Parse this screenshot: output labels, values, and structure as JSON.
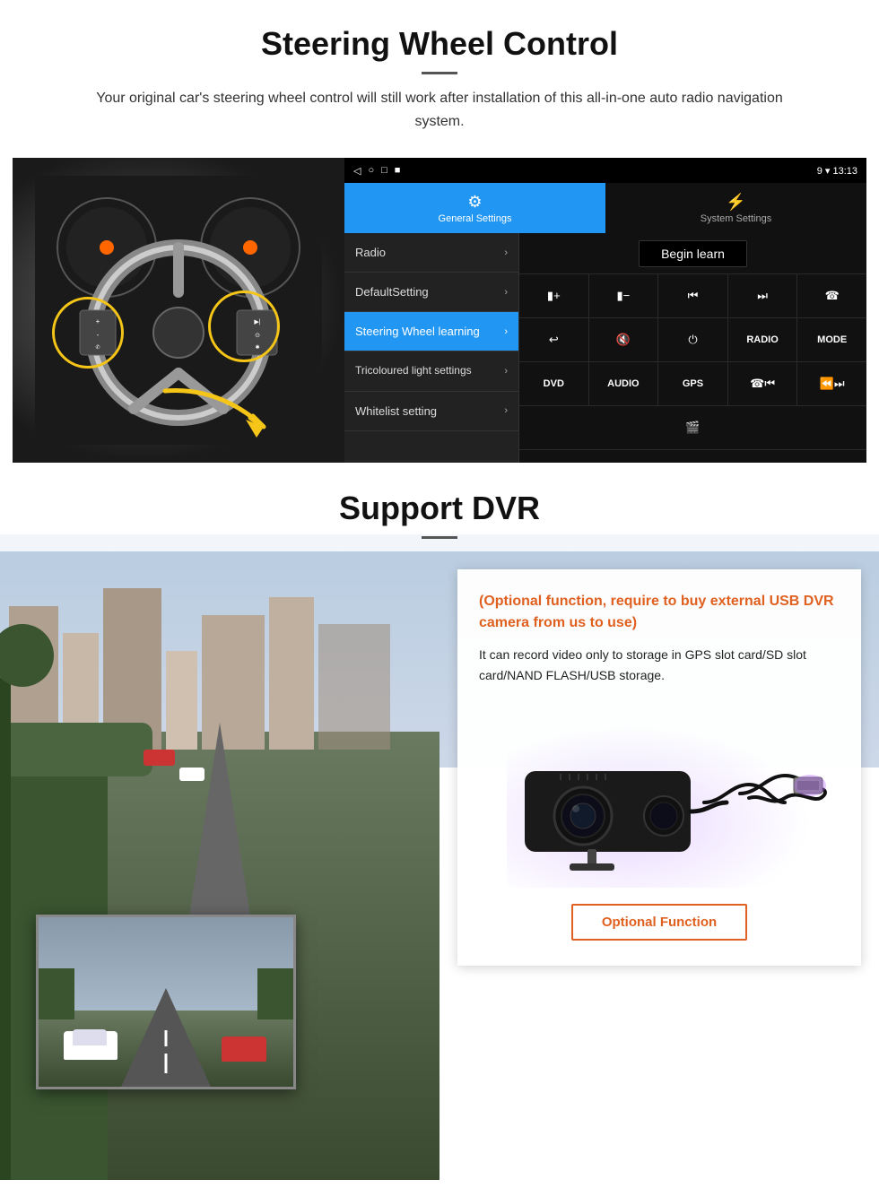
{
  "page": {
    "section1": {
      "title": "Steering Wheel Control",
      "description": "Your original car's steering wheel control will still work after installation of this all-in-one auto radio navigation system.",
      "android_ui": {
        "status_bar": {
          "nav_icons": [
            "◁",
            "○",
            "□",
            "■"
          ],
          "right_icons": "9 ▾  13:13"
        },
        "tabs": [
          {
            "label": "General Settings",
            "active": true
          },
          {
            "label": "System Settings",
            "active": false
          }
        ],
        "menu_items": [
          {
            "label": "Radio",
            "active": false
          },
          {
            "label": "DefaultSetting",
            "active": false
          },
          {
            "label": "Steering Wheel learning",
            "active": true
          },
          {
            "label": "Tricoloured light settings",
            "active": false
          },
          {
            "label": "Whitelist setting",
            "active": false
          }
        ],
        "begin_learn_label": "Begin learn",
        "control_buttons": [
          [
            "vol+",
            "vol-",
            "⏮",
            "⏭",
            "☎"
          ],
          [
            "↩",
            "🔇",
            "⏻",
            "RADIO",
            "MODE"
          ],
          [
            "DVD",
            "AUDIO",
            "GPS",
            "☎⏮",
            "⏪⏭"
          ],
          [
            "🎬"
          ]
        ]
      }
    },
    "section2": {
      "title": "Support DVR",
      "optional_text": "(Optional function, require to buy external USB DVR camera from us to use)",
      "description": "It can record video only to storage in GPS slot card/SD slot card/NAND FLASH/USB storage.",
      "optional_function_btn": "Optional Function"
    }
  }
}
